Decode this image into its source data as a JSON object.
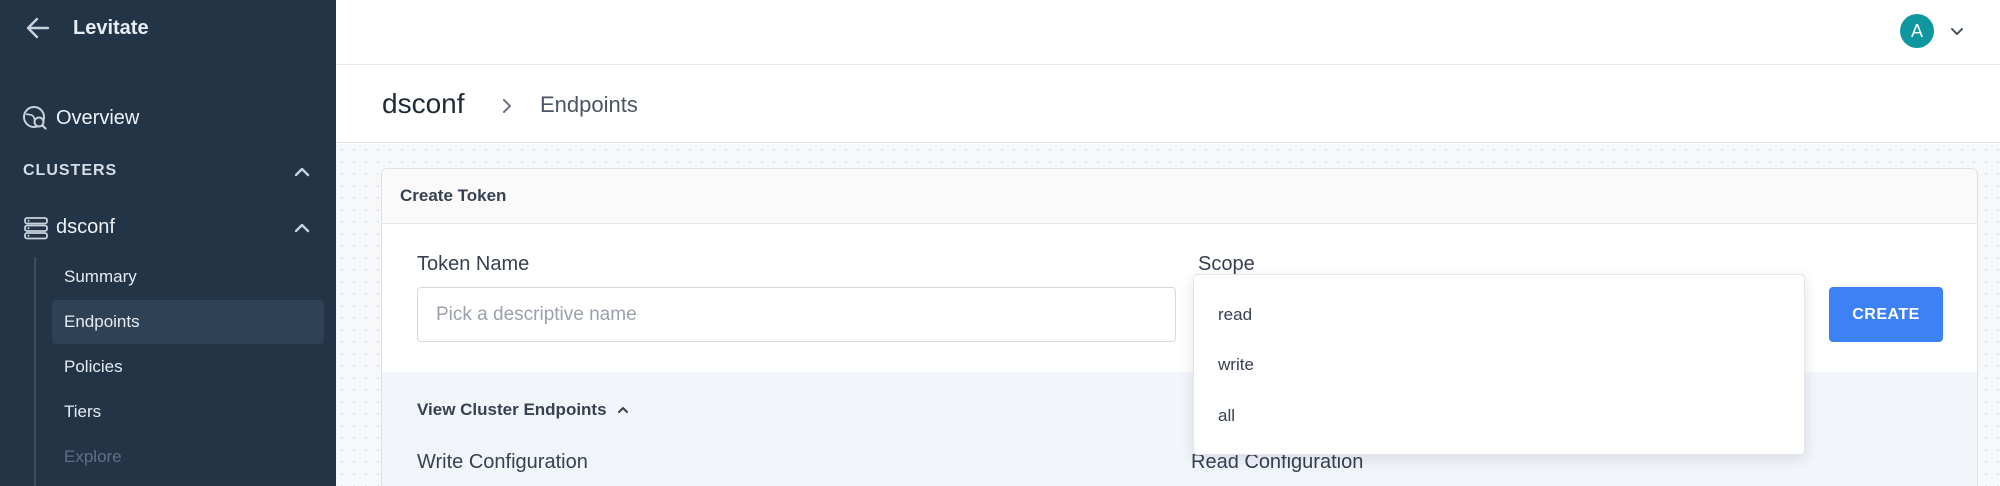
{
  "app": {
    "name": "Levitate"
  },
  "sidebar": {
    "overview_label": "Overview",
    "clusters_heading": "CLUSTERS",
    "cluster_name": "dsconf",
    "sub_items": [
      {
        "label": "Summary",
        "active": false,
        "disabled": false
      },
      {
        "label": "Endpoints",
        "active": true,
        "disabled": false
      },
      {
        "label": "Policies",
        "active": false,
        "disabled": false
      },
      {
        "label": "Tiers",
        "active": false,
        "disabled": false
      },
      {
        "label": "Explore",
        "active": false,
        "disabled": true
      }
    ]
  },
  "topbar": {
    "avatar_initial": "A"
  },
  "breadcrumb": {
    "root": "dsconf",
    "current": "Endpoints"
  },
  "create_token": {
    "title": "Create Token",
    "token_name_label": "Token Name",
    "token_name_placeholder": "Pick a descriptive name",
    "token_name_value": "",
    "scope_label": "Scope",
    "scope_options": [
      "read",
      "write",
      "all"
    ],
    "create_button": "CREATE"
  },
  "endpoints": {
    "toggle_label": "View Cluster Endpoints",
    "write_config_label": "Write Configuration",
    "read_config_label": "Read Configuration"
  },
  "colors": {
    "sidebar_bg": "#233447",
    "accent": "#3c82f6",
    "avatar": "#0f97a0"
  }
}
